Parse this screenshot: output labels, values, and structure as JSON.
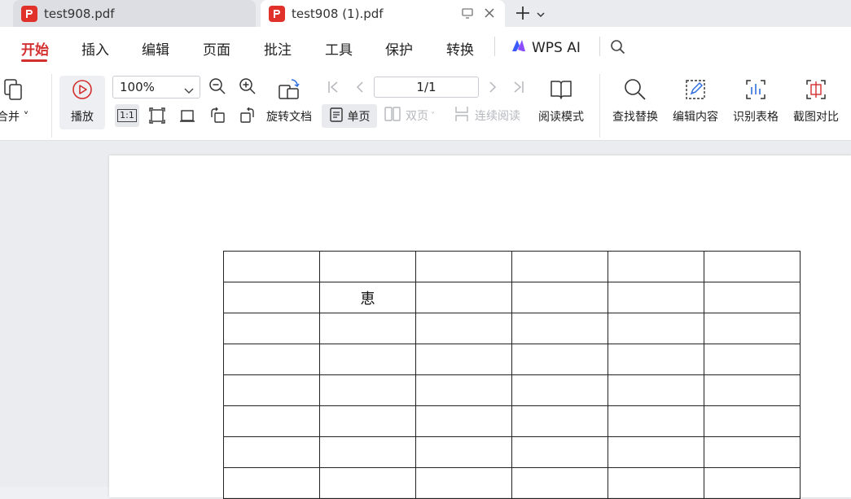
{
  "tabs": [
    {
      "title": "test908.pdf",
      "active": false
    },
    {
      "title": "test908 (1).pdf",
      "active": true
    }
  ],
  "menu": {
    "items": [
      "开始",
      "插入",
      "编辑",
      "页面",
      "批注",
      "工具",
      "保护",
      "转换"
    ],
    "active_index": 0,
    "ai_label": "WPS AI"
  },
  "toolbar": {
    "merge_label": "合并",
    "play_label": "播放",
    "zoom_value": "100%",
    "rotate_label": "旋转文档",
    "single_page_label": "单页",
    "double_page_label": "双页",
    "continuous_label": "连续阅读",
    "page_indicator": "1/1",
    "read_mode_label": "阅读模式",
    "find_replace_label": "查找替换",
    "edit_content_label": "编辑内容",
    "recognize_table_label": "识别表格",
    "screenshot_compare_label": "截图对比",
    "actual_size_label": "1:1"
  },
  "document": {
    "table": {
      "rows": [
        [
          "",
          "",
          "",
          "",
          "",
          ""
        ],
        [
          "",
          "恵",
          "",
          "",
          "",
          ""
        ],
        [
          "",
          "",
          "",
          "",
          "",
          ""
        ],
        [
          "",
          "",
          "",
          "",
          "",
          ""
        ],
        [
          "",
          "",
          "",
          "",
          "",
          ""
        ],
        [
          "",
          "",
          "",
          "",
          "",
          ""
        ],
        [
          "",
          "",
          "",
          "",
          "",
          ""
        ],
        [
          "",
          "",
          "",
          "",
          "",
          ""
        ]
      ]
    }
  },
  "colors": {
    "accent": "#d32f2f",
    "pdf_icon": "#e0322b"
  }
}
